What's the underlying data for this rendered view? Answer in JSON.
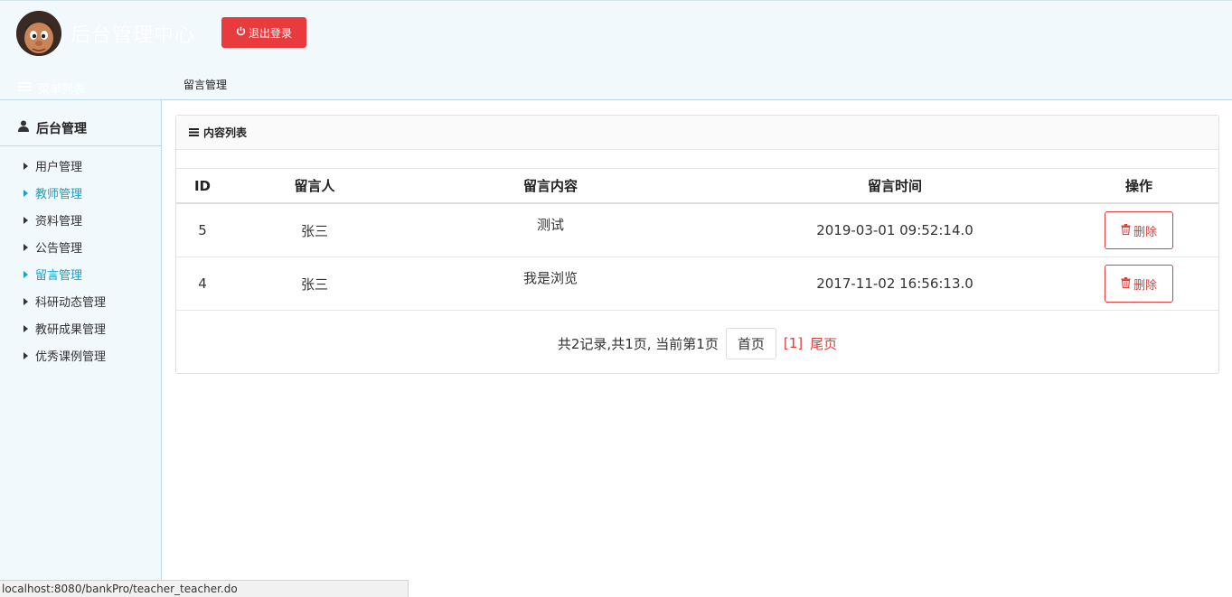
{
  "header": {
    "brand": "后台管理中心",
    "logout_label": "退出登录"
  },
  "menu": {
    "title": "菜单列表"
  },
  "breadcrumb": "留言管理",
  "sidebar": {
    "section": "后台管理",
    "items": [
      {
        "label": "用户管理",
        "active": false
      },
      {
        "label": "教师管理",
        "active": true
      },
      {
        "label": "资料管理",
        "active": false
      },
      {
        "label": "公告管理",
        "active": false
      },
      {
        "label": "留言管理",
        "active": true
      },
      {
        "label": " 科研动态管理",
        "active": false
      },
      {
        "label": "教研成果管理",
        "active": false
      },
      {
        "label": "优秀课例管理",
        "active": false
      }
    ]
  },
  "panel": {
    "title": "内容列表",
    "columns": {
      "id": "ID",
      "who": "留言人",
      "msg": "留言内容",
      "time": "留言时间",
      "op": "操作"
    },
    "rows": [
      {
        "id": "5",
        "who": "张三",
        "msg": "测试",
        "time": "2019-03-01 09:52:14.0",
        "op": "删除"
      },
      {
        "id": "4",
        "who": "张三",
        "msg": "我是浏览",
        "time": "2017-11-02 16:56:13.0",
        "op": "删除"
      }
    ],
    "pager": {
      "info": "共2记录,共1页, 当前第1页",
      "first": "首页",
      "current": "[1]",
      "last": "尾页"
    }
  },
  "status_url": "localhost:8080/bankPro/teacher_teacher.do",
  "colors": {
    "accent": "#1a9fc9",
    "danger": "#d9403f",
    "logout": "#e93a3d",
    "background": "#f2f9fc"
  }
}
